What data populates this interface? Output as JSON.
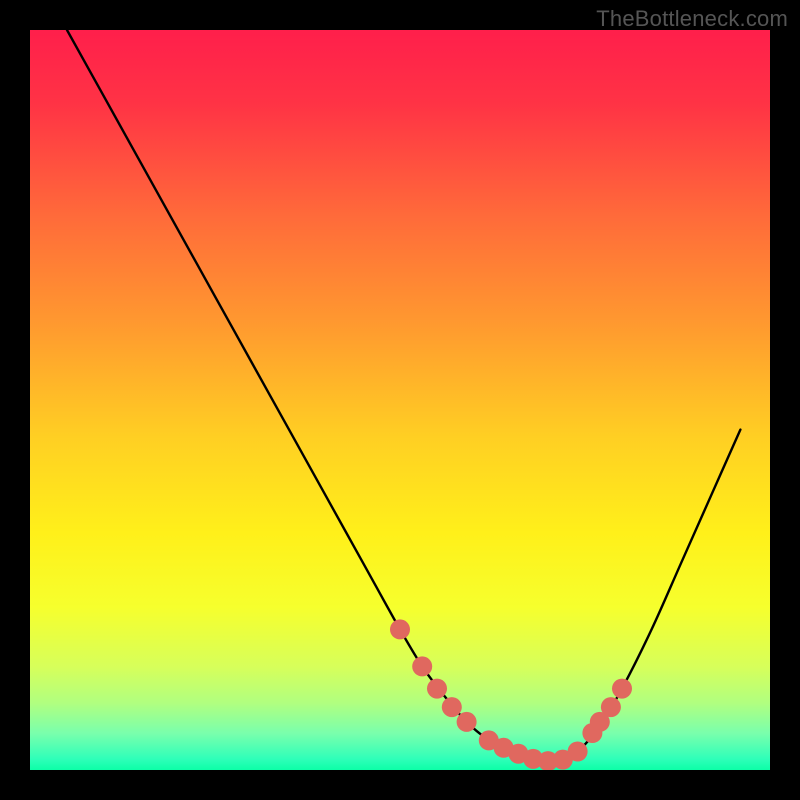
{
  "watermark": "TheBottleneck.com",
  "chart_data": {
    "type": "line",
    "title": "",
    "xlabel": "",
    "ylabel": "",
    "xlim": [
      0,
      100
    ],
    "ylim": [
      0,
      100
    ],
    "grid": false,
    "legend": "none",
    "background_gradient": {
      "stops": [
        {
          "offset": 0.0,
          "color": "#ff1f4b"
        },
        {
          "offset": 0.1,
          "color": "#ff3345"
        },
        {
          "offset": 0.25,
          "color": "#ff6a3a"
        },
        {
          "offset": 0.4,
          "color": "#ff9a2f"
        },
        {
          "offset": 0.55,
          "color": "#ffcf23"
        },
        {
          "offset": 0.68,
          "color": "#fff01a"
        },
        {
          "offset": 0.78,
          "color": "#f6ff2d"
        },
        {
          "offset": 0.86,
          "color": "#d7ff5a"
        },
        {
          "offset": 0.91,
          "color": "#b0ff80"
        },
        {
          "offset": 0.95,
          "color": "#7affac"
        },
        {
          "offset": 0.985,
          "color": "#2fffb9"
        },
        {
          "offset": 1.0,
          "color": "#0cffa7"
        }
      ]
    },
    "curve": {
      "x": [
        5,
        10,
        15,
        20,
        25,
        30,
        35,
        40,
        45,
        50,
        53,
        56,
        59,
        62,
        65,
        68,
        71,
        74,
        77,
        80,
        84,
        88,
        92,
        96
      ],
      "y": [
        100,
        91,
        82,
        73,
        64,
        55,
        46,
        37,
        28,
        19,
        14,
        10,
        6.5,
        4,
        2.2,
        1.2,
        1.2,
        2.5,
        6,
        11,
        19,
        28,
        37,
        46
      ]
    },
    "markers": {
      "x": [
        50,
        53,
        55,
        57,
        59,
        62,
        64,
        66,
        68,
        70,
        72,
        74,
        76,
        77,
        78.5,
        80
      ],
      "y": [
        19,
        14,
        11,
        8.5,
        6.5,
        4,
        3,
        2.2,
        1.5,
        1.2,
        1.4,
        2.5,
        5,
        6.5,
        8.5,
        11
      ],
      "color": "#e0685f",
      "radius": 10
    }
  }
}
